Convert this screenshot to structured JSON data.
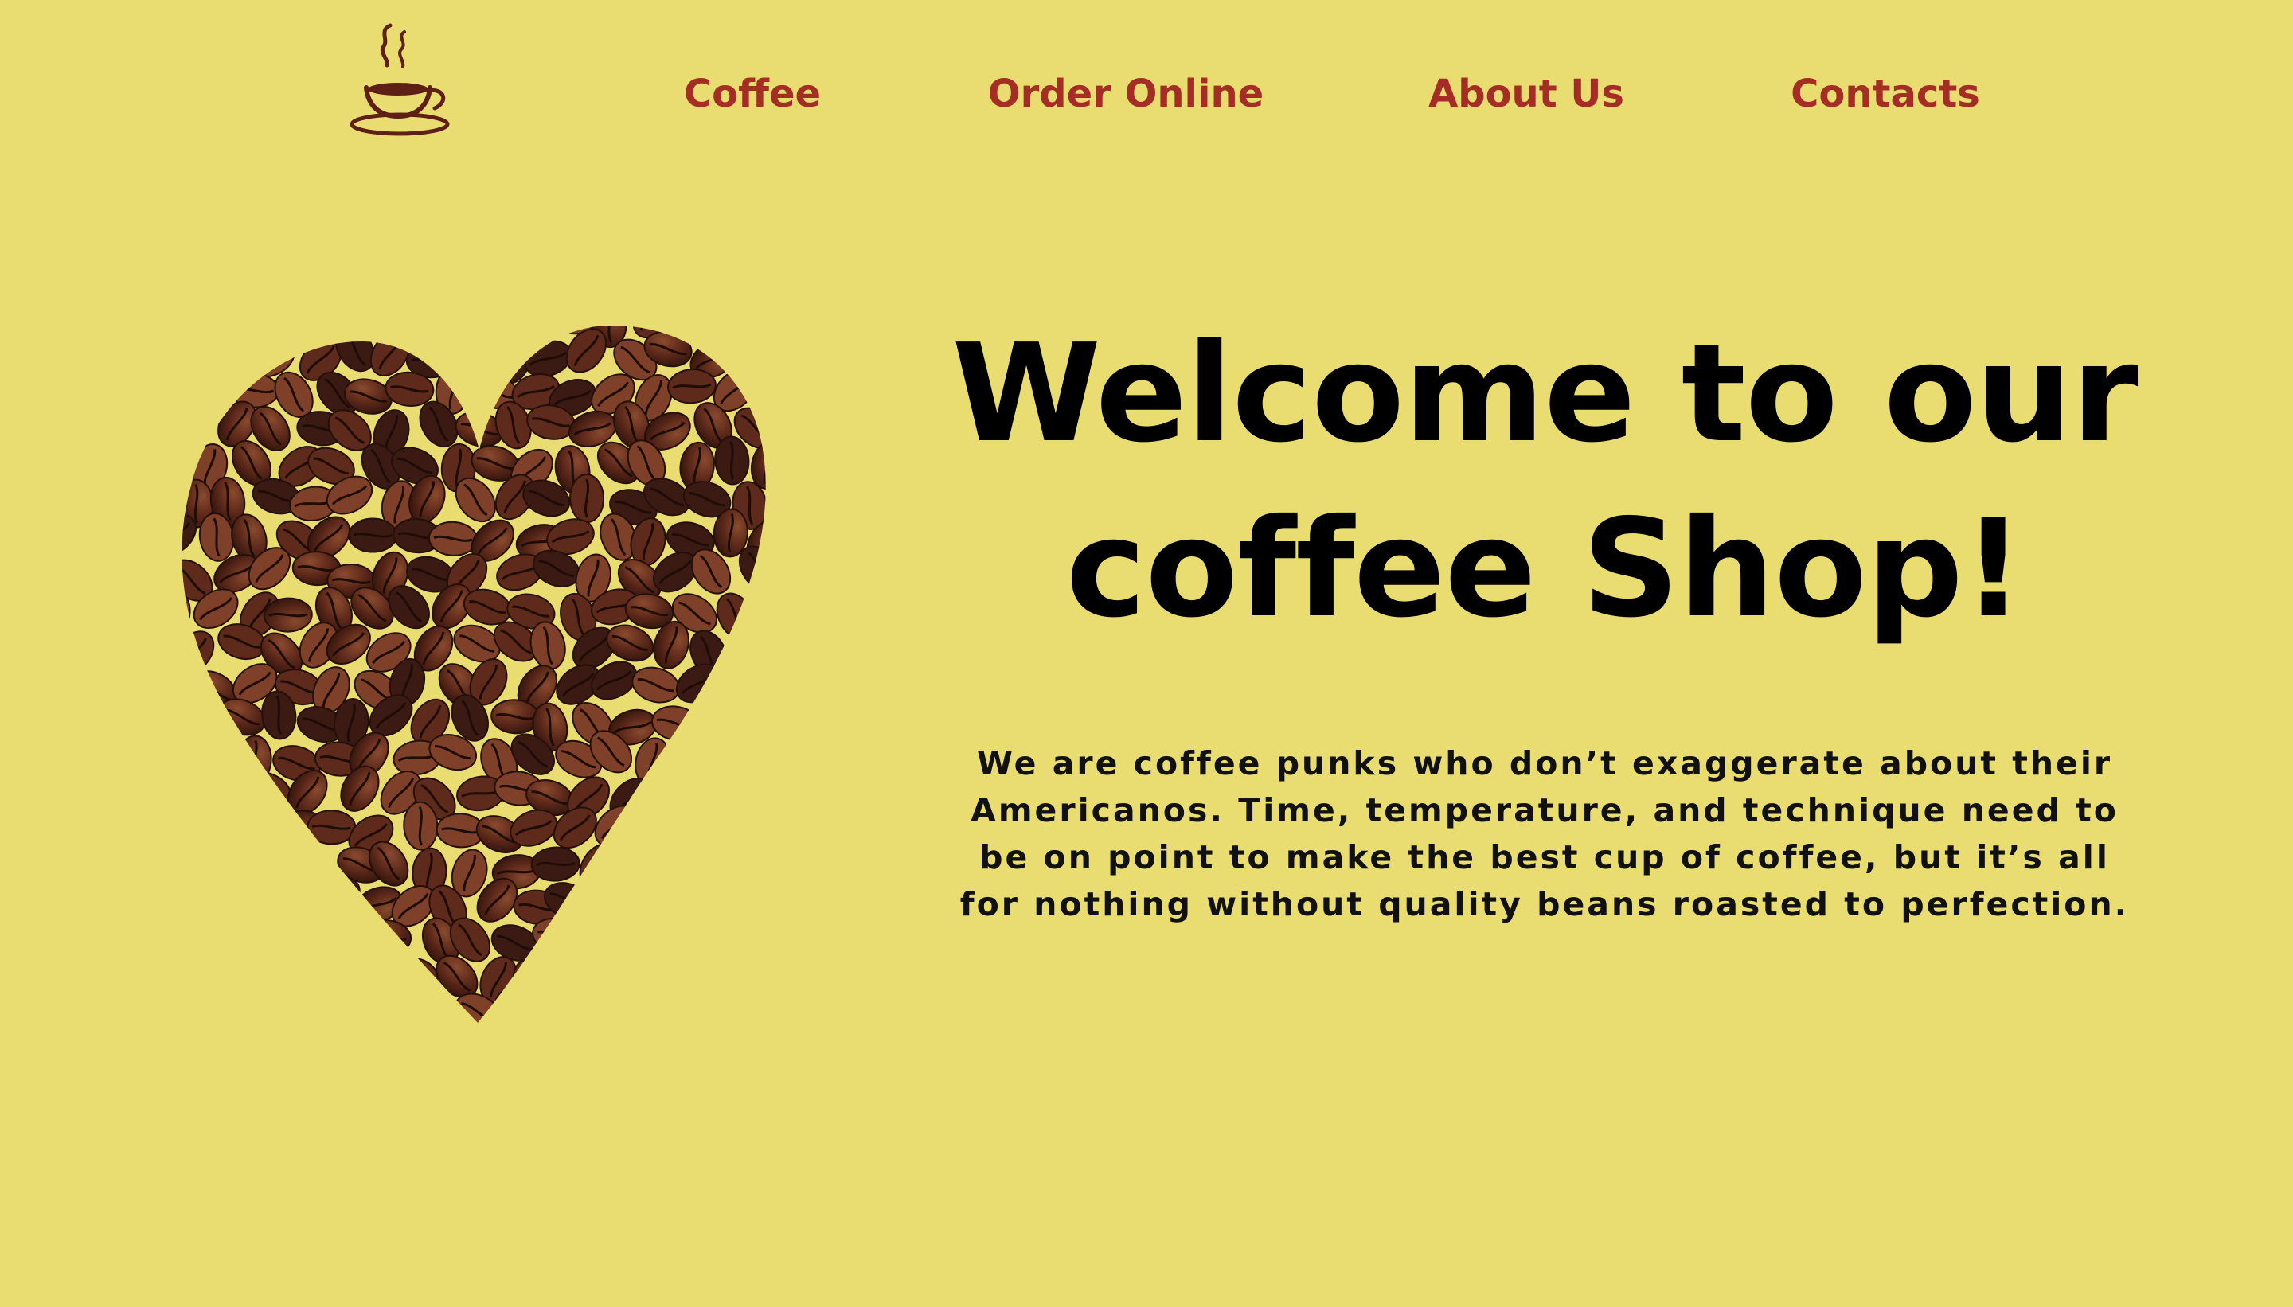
{
  "colors": {
    "background": "#E9DC70",
    "nav_text": "#A42E25",
    "heading_text": "#000000",
    "body_text": "#111111",
    "logo": "#5E1F14",
    "bean_dark": "#3A1A12",
    "bean_mid": "#5E2A1C",
    "bean_light": "#7E4029"
  },
  "header": {
    "logo_icon": "coffee-cup-logo",
    "nav": [
      {
        "label": "Coffee"
      },
      {
        "label": "Order Online"
      },
      {
        "label": "About Us"
      },
      {
        "label": "Contacts"
      }
    ]
  },
  "hero": {
    "image_icon": "coffee-bean-heart",
    "title_line1": "Welcome to our",
    "title_line2": "coffee Shop!",
    "description": "We are coffee punks who don’t exaggerate about their Americanos. Time, temperature, and technique need to be on point to make the best cup of coffee, but it’s all for nothing without quality beans roasted to perfection."
  }
}
